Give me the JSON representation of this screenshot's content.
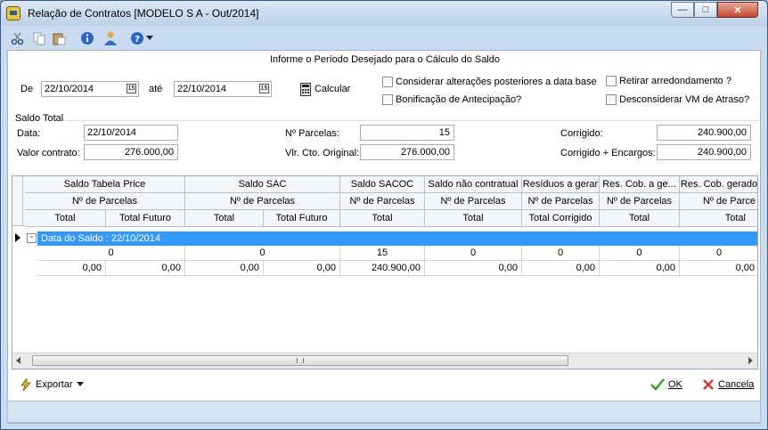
{
  "window": {
    "title": "Relação de Contratos [MODELO S A - Out/2014]"
  },
  "toolbar": {
    "items": [
      "scissors-icon",
      "copy-icon",
      "paste-icon",
      "info-icon",
      "user-icon",
      "help-icon",
      "dropdown-arrow-icon"
    ]
  },
  "form": {
    "heading": "Informe o Período Desejado para o Cálculo do Saldo",
    "de_label": "De",
    "de_value": "22/10/2014",
    "ate_label": "até",
    "ate_value": "22/10/2014",
    "calcular_label": "Calcular",
    "options": [
      {
        "label": "Considerar alterações posteriores a data base",
        "checked": false
      },
      {
        "label": "Bonificação de Antecipação?",
        "checked": false
      },
      {
        "label": "Retirar arredondamento ?",
        "checked": false
      },
      {
        "label": "Desconsiderar VM de Atraso?",
        "checked": false
      }
    ]
  },
  "saldo_total": {
    "legend": "Saldo Total",
    "data_label": "Data:",
    "data_value": "22/10/2014",
    "valor_contrato_label": "Valor contrato:",
    "valor_contrato_value": "276.000,00",
    "parcelas_label": "Nº Parcelas:",
    "parcelas_value": "15",
    "vlr_cto_label": "Vlr. Cto. Original:",
    "vlr_cto_value": "276.000,00",
    "corrigido_label": "Corrigido:",
    "corrigido_value": "240.900,00",
    "corrigido_encargos_label": "Corrigido + Encargos:",
    "corrigido_encargos_value": "240.900,00"
  },
  "grid": {
    "groups": [
      "Saldo Tabela Price",
      "Saldo SAC",
      "Saldo SACOC",
      "Saldo não contratual",
      "Resíduos a gerar",
      "Res. Cob. a ge...",
      "Res. Cob. gerado"
    ],
    "parcelas_headers": [
      "Nº de Parcelas",
      "Nº de Parcelas",
      "Nº de Parcelas",
      "Nº de Parcelas",
      "Nº de Parcelas",
      "Nº de Parcelas",
      "Nº de Parce"
    ],
    "total_headers": [
      "Total",
      "Total Futuro",
      "Total",
      "Total Futuro",
      "Total",
      "Total",
      "Total Corrigido",
      "Total",
      "Total"
    ],
    "group_row": "Data do Saldo : 22/10/2014",
    "row_parcelas": [
      "0",
      "0",
      "15",
      "0",
      "0",
      "0",
      "0"
    ],
    "row_totals": [
      "0,00",
      "0,00",
      "0,00",
      "0,00",
      "240.900,00",
      "0,00",
      "0,00",
      "0,00",
      "0,00"
    ]
  },
  "footer": {
    "exportar_label": "Exportar",
    "ok_label": "OK",
    "cancela_label": "Cancela"
  }
}
